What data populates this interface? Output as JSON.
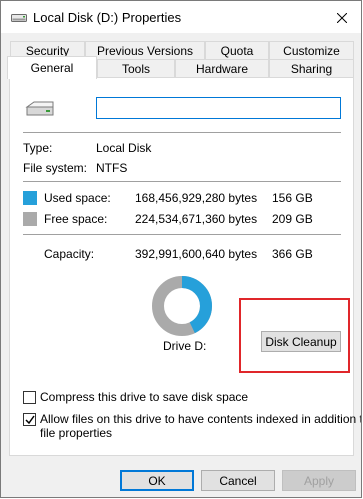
{
  "window": {
    "title": "Local Disk (D:) Properties",
    "icon": "drive-icon"
  },
  "tabs": {
    "row1": [
      "Security",
      "Previous Versions",
      "Quota",
      "Customize"
    ],
    "row2": [
      "General",
      "Tools",
      "Hardware",
      "Sharing"
    ],
    "active": "General"
  },
  "general": {
    "name_value": "",
    "type_label": "Type:",
    "type_value": "Local Disk",
    "fs_label": "File system:",
    "fs_value": "NTFS",
    "used": {
      "label": "Used space:",
      "bytes": "168,456,929,280 bytes",
      "size": "156 GB",
      "color": "#26a0da"
    },
    "free": {
      "label": "Free space:",
      "bytes": "224,534,671,360 bytes",
      "size": "209 GB",
      "color": "#aaaaaa"
    },
    "capacity": {
      "label": "Capacity:",
      "bytes": "392,991,600,640 bytes",
      "size": "366 GB"
    },
    "used_fraction": 0.4287,
    "drive_label": "Drive D:",
    "disk_cleanup": "Disk Cleanup",
    "compress": {
      "label": "Compress this drive to save disk space",
      "checked": false
    },
    "index": {
      "label_line1": "Allow files on this drive to have contents indexed in addition to",
      "label_line2": "file properties",
      "checked": true
    }
  },
  "buttons": {
    "ok": "OK",
    "cancel": "Cancel",
    "apply": "Apply"
  },
  "colors": {
    "accent": "#0078d7",
    "highlight": "#e0262a"
  }
}
